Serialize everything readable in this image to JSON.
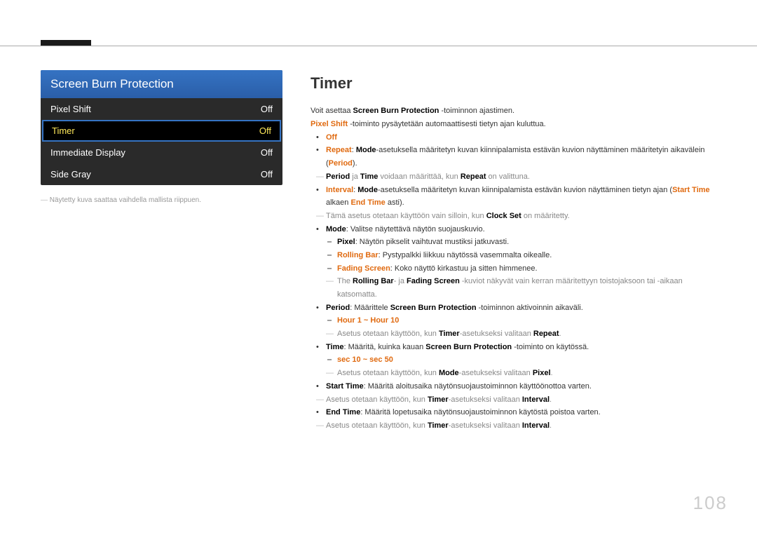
{
  "menu": {
    "title": "Screen Burn Protection",
    "rows": [
      {
        "label": "Pixel Shift",
        "value": "Off",
        "selected": false
      },
      {
        "label": "Timer",
        "value": "Off",
        "selected": true
      },
      {
        "label": "Immediate Display",
        "value": "Off",
        "selected": false
      },
      {
        "label": "Side Gray",
        "value": "Off",
        "selected": false
      }
    ],
    "note": "Näytetty kuva saattaa vaihdella mallista riippuen."
  },
  "section_title": "Timer",
  "intro1_pre": "Voit asettaa ",
  "intro1_b": "Screen Burn Protection",
  "intro1_post": " -toiminnon ajastimen.",
  "intro2_b": "Pixel Shift",
  "intro2_post": " -toiminto pysäytetään automaattisesti tietyn ajan kuluttua.",
  "b1_off": "Off",
  "b2_repeat": "Repeat",
  "b2_mode": "Mode",
  "b2_text_mid": "-asetuksella määritetyn kuvan kiinnipalamista estävän kuvion näyttäminen määritetyin aikavälein (",
  "b2_period": "Period",
  "b2_end": ").",
  "b2_sub_pre": "",
  "b2_sub_b1": "Period",
  "b2_sub_mid1": " ja ",
  "b2_sub_b2": "Time",
  "b2_sub_mid2": " voidaan määrittää, kun ",
  "b2_sub_b3": "Repeat",
  "b2_sub_end": " on valittuna.",
  "b3_interval": "Interval",
  "b3_mode": "Mode",
  "b3_mid": "-asetuksella määritetyn kuvan kiinnipalamista estävän kuvion näyttäminen tietyn ajan (",
  "b3_start": "Start Time",
  "b3_mid2": " alkaen ",
  "b3_end": "End Time",
  "b3_post": " asti).",
  "b3_note_pre": "Tämä asetus otetaan käyttöön vain silloin, kun ",
  "b3_note_b": "Clock Set",
  "b3_note_post": " on määritetty.",
  "b4_mode": "Mode",
  "b4_text": ": Valitse näytettävä näytön suojauskuvio.",
  "b4_s1_b": "Pixel",
  "b4_s1_t": ": Näytön pikselit vaihtuvat mustiksi jatkuvasti.",
  "b4_s2_b": "Rolling Bar",
  "b4_s2_t": ": Pystypalkki liikkuu näytössä vasemmalta oikealle.",
  "b4_s3_b": "Fading Screen",
  "b4_s3_t": ": Koko näyttö kirkastuu ja sitten himmenee.",
  "b4_note_pre": "The ",
  "b4_note_b1": "Rolling Bar",
  "b4_note_mid": "- ja ",
  "b4_note_b2": "Fading Screen",
  "b4_note_post": " -kuviot näkyvät vain kerran määritettyyn toistojaksoon tai -aikaan katsomatta.",
  "b5_period": "Period",
  "b5_mid": ": Määrittele ",
  "b5_sbp": "Screen Burn Protection",
  "b5_post": " -toiminnon aktivoinnin aikaväli.",
  "b5_range": "Hour 1 ~ Hour 10",
  "b5_note_pre": "Asetus otetaan käyttöön, kun ",
  "b5_note_b1": "Timer",
  "b5_note_mid": "-asetukseksi valitaan ",
  "b5_note_b2": "Repeat",
  "b5_note_end": ".",
  "b6_time": "Time",
  "b6_mid": ": Määritä, kuinka kauan ",
  "b6_sbp": "Screen Burn Protection",
  "b6_post": " -toiminto on käytössä.",
  "b6_range": "sec 10 ~ sec 50",
  "b6_note_pre": "Asetus otetaan käyttöön, kun ",
  "b6_note_b1": "Mode",
  "b6_note_mid": "-asetukseksi valitaan ",
  "b6_note_b2": "Pixel",
  "b6_note_end": ".",
  "b7_start": "Start Time",
  "b7_text": ": Määritä aloitusaika näytönsuojaustoiminnon käyttöönottoa varten.",
  "b7_note_pre": "Asetus otetaan käyttöön, kun ",
  "b7_note_b1": "Timer",
  "b7_note_mid": "-asetukseksi valitaan ",
  "b7_note_b2": "Interval",
  "b7_note_end": ".",
  "b8_end": "End Time",
  "b8_text": ": Määritä lopetusaika näytönsuojaustoiminnon käytöstä poistoa varten.",
  "b8_note_pre": "Asetus otetaan käyttöön, kun ",
  "b8_note_b1": "Timer",
  "b8_note_mid": "-asetukseksi valitaan ",
  "b8_note_b2": "Interval",
  "b8_note_end": ".",
  "page_number": "108"
}
